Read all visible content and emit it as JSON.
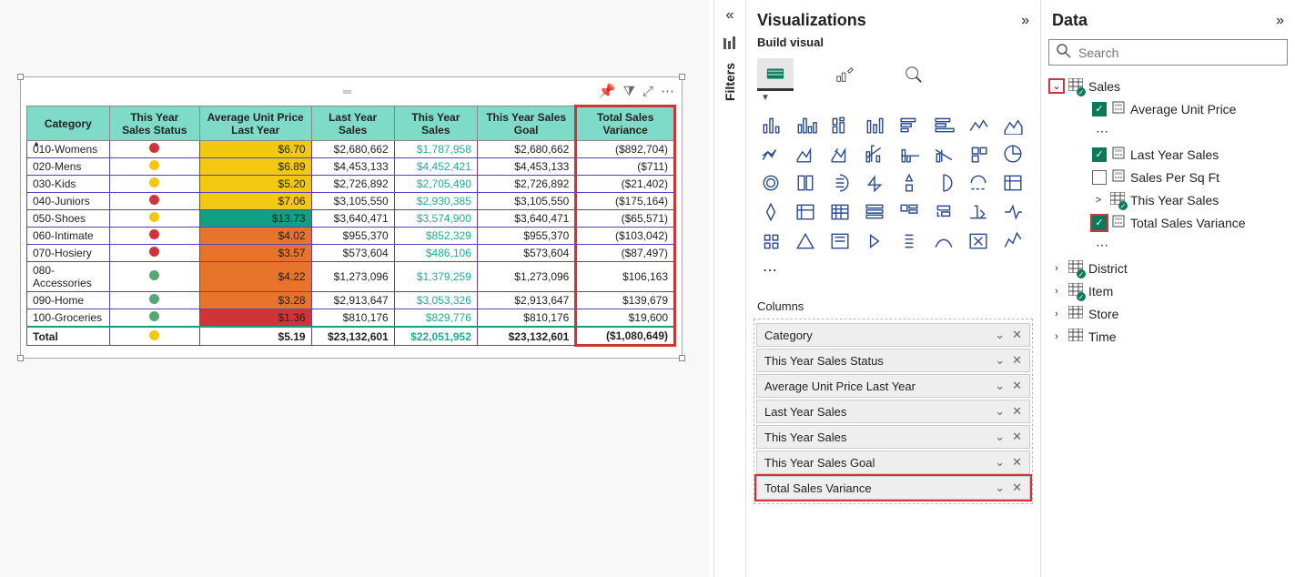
{
  "panels": {
    "filters": {
      "label": "Filters"
    },
    "visualizations": {
      "title": "Visualizations",
      "subtitle": "Build visual",
      "columns_label": "Columns"
    },
    "data": {
      "title": "Data",
      "search_placeholder": "Search"
    }
  },
  "table": {
    "headers": [
      "Category",
      "This Year Sales Status",
      "Average Unit Price Last Year",
      "Last Year Sales",
      "This Year Sales",
      "This Year Sales Goal",
      "Total Sales Variance"
    ],
    "rows": [
      {
        "cat": "010-Womens",
        "status": "red",
        "avg": "$6.70",
        "avg_bg": "#f2c811",
        "ly": "$2,680,662",
        "ty": "$1,787,958",
        "goal": "$2,680,662",
        "var": "($892,704)"
      },
      {
        "cat": "020-Mens",
        "status": "yellow",
        "avg": "$6.89",
        "avg_bg": "#f2c811",
        "ly": "$4,453,133",
        "ty": "$4,452,421",
        "goal": "$4,453,133",
        "var": "($711)"
      },
      {
        "cat": "030-Kids",
        "status": "yellow",
        "avg": "$5.20",
        "avg_bg": "#f2c811",
        "ly": "$2,726,892",
        "ty": "$2,705,490",
        "goal": "$2,726,892",
        "var": "($21,402)"
      },
      {
        "cat": "040-Juniors",
        "status": "red",
        "avg": "$7.06",
        "avg_bg": "#f2c811",
        "ly": "$3,105,550",
        "ty": "$2,930,385",
        "goal": "$3,105,550",
        "var": "($175,164)"
      },
      {
        "cat": "050-Shoes",
        "status": "yellow",
        "avg": "$13.73",
        "avg_bg": "#12a085",
        "ly": "$3,640,471",
        "ty": "$3,574,900",
        "goal": "$3,640,471",
        "var": "($65,571)"
      },
      {
        "cat": "060-Intimate",
        "status": "red",
        "avg": "$4.02",
        "avg_bg": "#e8732b",
        "ly": "$955,370",
        "ty": "$852,329",
        "goal": "$955,370",
        "var": "($103,042)"
      },
      {
        "cat": "070-Hosiery",
        "status": "red",
        "avg": "$3.57",
        "avg_bg": "#e8732b",
        "ly": "$573,604",
        "ty": "$486,106",
        "goal": "$573,604",
        "var": "($87,497)"
      },
      {
        "cat": "080-Accessories",
        "status": "green",
        "avg": "$4.22",
        "avg_bg": "#e8732b",
        "ly": "$1,273,096",
        "ty": "$1,379,259",
        "goal": "$1,273,096",
        "var": "$106,163"
      },
      {
        "cat": "090-Home",
        "status": "green",
        "avg": "$3.28",
        "avg_bg": "#e8732b",
        "ly": "$2,913,647",
        "ty": "$3,053,326",
        "goal": "$2,913,647",
        "var": "$139,679"
      },
      {
        "cat": "100-Groceries",
        "status": "green",
        "avg": "$1.36",
        "avg_bg": "#d13438",
        "ly": "$810,176",
        "ty": "$829,776",
        "goal": "$810,176",
        "var": "$19,600"
      }
    ],
    "total": {
      "label": "Total",
      "status": "yellow",
      "avg": "$5.19",
      "ly": "$23,132,601",
      "ty": "$22,051,952",
      "goal": "$23,132,601",
      "var": "($1,080,649)"
    }
  },
  "columns_well": [
    {
      "label": "Category",
      "hl": false
    },
    {
      "label": "This Year Sales Status",
      "hl": false
    },
    {
      "label": "Average Unit Price Last Year",
      "hl": false
    },
    {
      "label": "Last Year Sales",
      "hl": false
    },
    {
      "label": "This Year Sales",
      "hl": false
    },
    {
      "label": "This Year Sales Goal",
      "hl": false
    },
    {
      "label": "Total Sales Variance",
      "hl": true
    }
  ],
  "data_tree": {
    "sales": {
      "label": "Sales",
      "fields": [
        {
          "label": "Average Unit Price",
          "checked": true,
          "kind": "measure",
          "exp": null
        },
        {
          "label": "Last Year Sales",
          "checked": true,
          "kind": "measure",
          "exp": null
        },
        {
          "label": "Sales Per Sq Ft",
          "checked": false,
          "kind": "measure",
          "exp": null
        },
        {
          "label": "This Year Sales",
          "checked": null,
          "kind": "table",
          "exp": ">"
        },
        {
          "label": "Total Sales Variance",
          "checked": true,
          "kind": "measure",
          "exp": null,
          "hl": true
        }
      ]
    },
    "other_tables": [
      "District",
      "Item",
      "Store",
      "Time"
    ]
  }
}
